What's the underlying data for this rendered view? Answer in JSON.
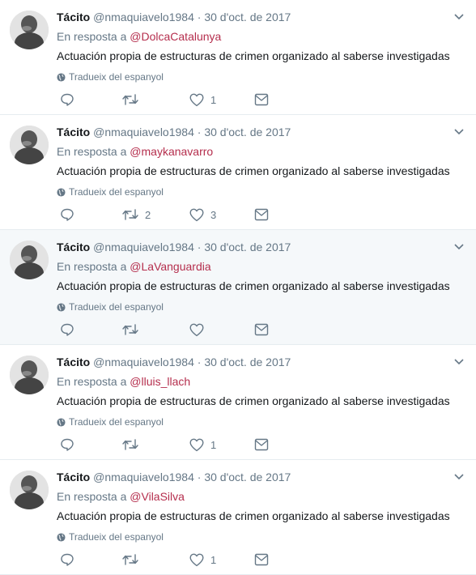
{
  "colors": {
    "mention": "#b52e4d",
    "meta": "#657786",
    "text": "#14171a",
    "hover_bg": "#f5f8fa"
  },
  "icons": {
    "reply": "reply-icon",
    "retweet": "retweet-icon",
    "like": "heart-icon",
    "dm": "envelope-icon",
    "translate": "globe-icon",
    "caret": "chevron-down-icon"
  },
  "tweets": [
    {
      "name": "Tácito",
      "handle": "@nmaquiavelo1984",
      "sep": "·",
      "time": "30 d'oct. de 2017",
      "reply_prefix": "En resposta a",
      "mention": "@DolcaCatalunya",
      "text": "Actuación propia de estructuras de crimen organizado al saberse investigadas",
      "translate": "Tradueix del espanyol",
      "retweets": "",
      "likes": "1"
    },
    {
      "name": "Tácito",
      "handle": "@nmaquiavelo1984",
      "sep": "·",
      "time": "30 d'oct. de 2017",
      "reply_prefix": "En resposta a",
      "mention": "@maykanavarro",
      "text": "Actuación propia de estructuras de crimen organizado al saberse investigadas",
      "translate": "Tradueix del espanyol",
      "retweets": "2",
      "likes": "3"
    },
    {
      "name": "Tácito",
      "handle": "@nmaquiavelo1984",
      "sep": "·",
      "time": "30 d'oct. de 2017",
      "reply_prefix": "En resposta a",
      "mention": "@LaVanguardia",
      "text": "Actuación propia de estructuras de crimen organizado al saberse investigadas",
      "translate": "Tradueix del espanyol",
      "retweets": "",
      "likes": ""
    },
    {
      "name": "Tácito",
      "handle": "@nmaquiavelo1984",
      "sep": "·",
      "time": "30 d'oct. de 2017",
      "reply_prefix": "En resposta a",
      "mention": "@lluis_llach",
      "text": "Actuación propia de estructuras de crimen organizado al saberse investigadas",
      "translate": "Tradueix del espanyol",
      "retweets": "",
      "likes": "1"
    },
    {
      "name": "Tácito",
      "handle": "@nmaquiavelo1984",
      "sep": "·",
      "time": "30 d'oct. de 2017",
      "reply_prefix": "En resposta a",
      "mention": "@VilaSilva",
      "text": "Actuación propia de estructuras de crimen organizado al saberse investigadas",
      "translate": "Tradueix del espanyol",
      "retweets": "",
      "likes": "1"
    }
  ]
}
